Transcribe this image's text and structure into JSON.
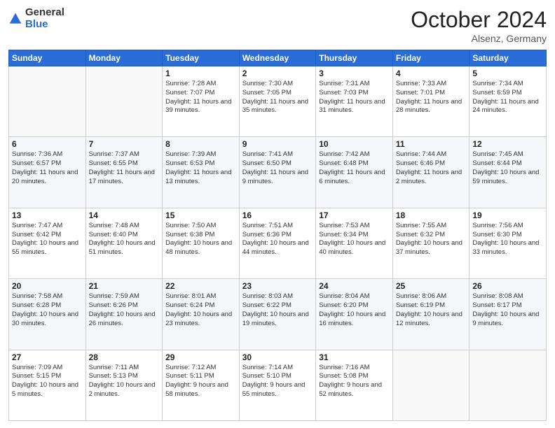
{
  "header": {
    "logo_general": "General",
    "logo_blue": "Blue",
    "month_title": "October 2024",
    "location": "Alsenz, Germany"
  },
  "days_of_week": [
    "Sunday",
    "Monday",
    "Tuesday",
    "Wednesday",
    "Thursday",
    "Friday",
    "Saturday"
  ],
  "weeks": [
    [
      {
        "day": "",
        "info": ""
      },
      {
        "day": "",
        "info": ""
      },
      {
        "day": "1",
        "info": "Sunrise: 7:28 AM\nSunset: 7:07 PM\nDaylight: 11 hours and 39 minutes."
      },
      {
        "day": "2",
        "info": "Sunrise: 7:30 AM\nSunset: 7:05 PM\nDaylight: 11 hours and 35 minutes."
      },
      {
        "day": "3",
        "info": "Sunrise: 7:31 AM\nSunset: 7:03 PM\nDaylight: 11 hours and 31 minutes."
      },
      {
        "day": "4",
        "info": "Sunrise: 7:33 AM\nSunset: 7:01 PM\nDaylight: 11 hours and 28 minutes."
      },
      {
        "day": "5",
        "info": "Sunrise: 7:34 AM\nSunset: 6:59 PM\nDaylight: 11 hours and 24 minutes."
      }
    ],
    [
      {
        "day": "6",
        "info": "Sunrise: 7:36 AM\nSunset: 6:57 PM\nDaylight: 11 hours and 20 minutes."
      },
      {
        "day": "7",
        "info": "Sunrise: 7:37 AM\nSunset: 6:55 PM\nDaylight: 11 hours and 17 minutes."
      },
      {
        "day": "8",
        "info": "Sunrise: 7:39 AM\nSunset: 6:53 PM\nDaylight: 11 hours and 13 minutes."
      },
      {
        "day": "9",
        "info": "Sunrise: 7:41 AM\nSunset: 6:50 PM\nDaylight: 11 hours and 9 minutes."
      },
      {
        "day": "10",
        "info": "Sunrise: 7:42 AM\nSunset: 6:48 PM\nDaylight: 11 hours and 6 minutes."
      },
      {
        "day": "11",
        "info": "Sunrise: 7:44 AM\nSunset: 6:46 PM\nDaylight: 11 hours and 2 minutes."
      },
      {
        "day": "12",
        "info": "Sunrise: 7:45 AM\nSunset: 6:44 PM\nDaylight: 10 hours and 59 minutes."
      }
    ],
    [
      {
        "day": "13",
        "info": "Sunrise: 7:47 AM\nSunset: 6:42 PM\nDaylight: 10 hours and 55 minutes."
      },
      {
        "day": "14",
        "info": "Sunrise: 7:48 AM\nSunset: 6:40 PM\nDaylight: 10 hours and 51 minutes."
      },
      {
        "day": "15",
        "info": "Sunrise: 7:50 AM\nSunset: 6:38 PM\nDaylight: 10 hours and 48 minutes."
      },
      {
        "day": "16",
        "info": "Sunrise: 7:51 AM\nSunset: 6:36 PM\nDaylight: 10 hours and 44 minutes."
      },
      {
        "day": "17",
        "info": "Sunrise: 7:53 AM\nSunset: 6:34 PM\nDaylight: 10 hours and 40 minutes."
      },
      {
        "day": "18",
        "info": "Sunrise: 7:55 AM\nSunset: 6:32 PM\nDaylight: 10 hours and 37 minutes."
      },
      {
        "day": "19",
        "info": "Sunrise: 7:56 AM\nSunset: 6:30 PM\nDaylight: 10 hours and 33 minutes."
      }
    ],
    [
      {
        "day": "20",
        "info": "Sunrise: 7:58 AM\nSunset: 6:28 PM\nDaylight: 10 hours and 30 minutes."
      },
      {
        "day": "21",
        "info": "Sunrise: 7:59 AM\nSunset: 6:26 PM\nDaylight: 10 hours and 26 minutes."
      },
      {
        "day": "22",
        "info": "Sunrise: 8:01 AM\nSunset: 6:24 PM\nDaylight: 10 hours and 23 minutes."
      },
      {
        "day": "23",
        "info": "Sunrise: 8:03 AM\nSunset: 6:22 PM\nDaylight: 10 hours and 19 minutes."
      },
      {
        "day": "24",
        "info": "Sunrise: 8:04 AM\nSunset: 6:20 PM\nDaylight: 10 hours and 16 minutes."
      },
      {
        "day": "25",
        "info": "Sunrise: 8:06 AM\nSunset: 6:19 PM\nDaylight: 10 hours and 12 minutes."
      },
      {
        "day": "26",
        "info": "Sunrise: 8:08 AM\nSunset: 6:17 PM\nDaylight: 10 hours and 9 minutes."
      }
    ],
    [
      {
        "day": "27",
        "info": "Sunrise: 7:09 AM\nSunset: 5:15 PM\nDaylight: 10 hours and 5 minutes."
      },
      {
        "day": "28",
        "info": "Sunrise: 7:11 AM\nSunset: 5:13 PM\nDaylight: 10 hours and 2 minutes."
      },
      {
        "day": "29",
        "info": "Sunrise: 7:12 AM\nSunset: 5:11 PM\nDaylight: 9 hours and 58 minutes."
      },
      {
        "day": "30",
        "info": "Sunrise: 7:14 AM\nSunset: 5:10 PM\nDaylight: 9 hours and 55 minutes."
      },
      {
        "day": "31",
        "info": "Sunrise: 7:16 AM\nSunset: 5:08 PM\nDaylight: 9 hours and 52 minutes."
      },
      {
        "day": "",
        "info": ""
      },
      {
        "day": "",
        "info": ""
      }
    ]
  ]
}
